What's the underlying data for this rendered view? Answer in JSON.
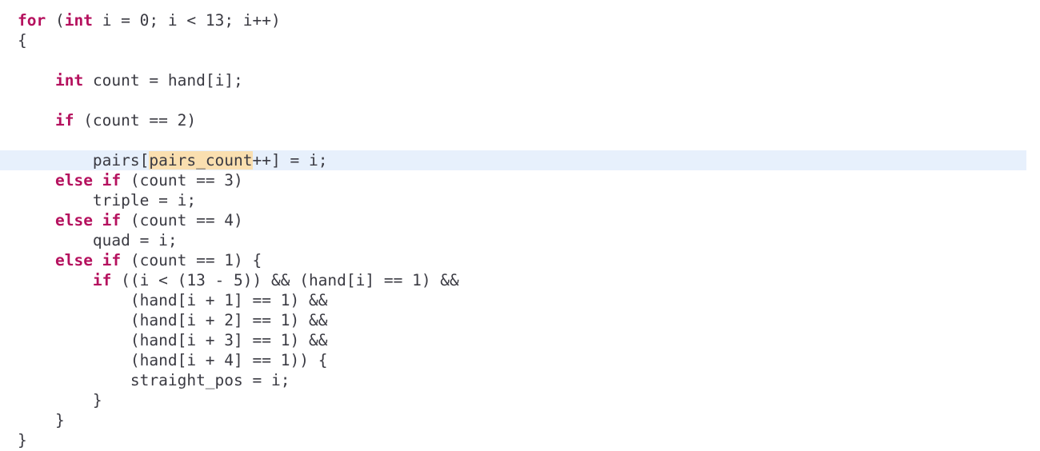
{
  "editor": {
    "language": "c",
    "current_line_number": 7,
    "colors": {
      "background": "#ffffff",
      "foreground": "#3a3a42",
      "keyword": "#b5115e",
      "current_line_highlight": "#e7f0fc",
      "occurrence_highlight": "#fadfb0"
    },
    "occurrence_highlight_text": "pairs_count"
  },
  "code": {
    "lines": [
      {
        "indent": "",
        "segments": [
          {
            "text": "for",
            "type": "keyword"
          },
          {
            "text": " (",
            "type": "plain"
          },
          {
            "text": "int",
            "type": "keyword"
          },
          {
            "text": " i = 0; i < 13; i++)",
            "type": "plain"
          }
        ]
      },
      {
        "indent": "",
        "segments": [
          {
            "text": "{",
            "type": "plain"
          }
        ]
      },
      {
        "indent": "",
        "segments": []
      },
      {
        "indent": "    ",
        "segments": [
          {
            "text": "int",
            "type": "keyword"
          },
          {
            "text": " count = hand[i];",
            "type": "plain"
          }
        ]
      },
      {
        "indent": "",
        "segments": []
      },
      {
        "indent": "    ",
        "segments": [
          {
            "text": "if",
            "type": "keyword"
          },
          {
            "text": " (count == 2)",
            "type": "plain"
          }
        ]
      },
      {
        "indent": "",
        "segments": []
      },
      {
        "indent": "        ",
        "highlighted": true,
        "segments": [
          {
            "text": "pairs[",
            "type": "plain"
          },
          {
            "text": "pairs_count",
            "type": "occurrence"
          },
          {
            "text": "++] = i;",
            "type": "plain"
          }
        ]
      },
      {
        "indent": "    ",
        "segments": [
          {
            "text": "else if",
            "type": "keyword"
          },
          {
            "text": " (count == 3)",
            "type": "plain"
          }
        ]
      },
      {
        "indent": "        ",
        "segments": [
          {
            "text": "triple = i;",
            "type": "plain"
          }
        ]
      },
      {
        "indent": "    ",
        "segments": [
          {
            "text": "else if",
            "type": "keyword"
          },
          {
            "text": " (count == 4)",
            "type": "plain"
          }
        ]
      },
      {
        "indent": "        ",
        "segments": [
          {
            "text": "quad = i;",
            "type": "plain"
          }
        ]
      },
      {
        "indent": "    ",
        "segments": [
          {
            "text": "else if",
            "type": "keyword"
          },
          {
            "text": " (count == 1) {",
            "type": "plain"
          }
        ]
      },
      {
        "indent": "        ",
        "segments": [
          {
            "text": "if",
            "type": "keyword"
          },
          {
            "text": " ((i < (13 - 5)) && (hand[i] == 1) &&",
            "type": "plain"
          }
        ]
      },
      {
        "indent": "            ",
        "segments": [
          {
            "text": "(hand[i + 1] == 1) &&",
            "type": "plain"
          }
        ]
      },
      {
        "indent": "            ",
        "segments": [
          {
            "text": "(hand[i + 2] == 1) &&",
            "type": "plain"
          }
        ]
      },
      {
        "indent": "            ",
        "segments": [
          {
            "text": "(hand[i + 3] == 1) &&",
            "type": "plain"
          }
        ]
      },
      {
        "indent": "            ",
        "segments": [
          {
            "text": "(hand[i + 4] == 1)) {",
            "type": "plain"
          }
        ]
      },
      {
        "indent": "            ",
        "segments": [
          {
            "text": "straight_pos = i;",
            "type": "plain"
          }
        ]
      },
      {
        "indent": "        ",
        "segments": [
          {
            "text": "}",
            "type": "plain"
          }
        ]
      },
      {
        "indent": "    ",
        "segments": [
          {
            "text": "}",
            "type": "plain"
          }
        ]
      },
      {
        "indent": "",
        "segments": [
          {
            "text": "}",
            "type": "plain"
          }
        ]
      }
    ]
  }
}
